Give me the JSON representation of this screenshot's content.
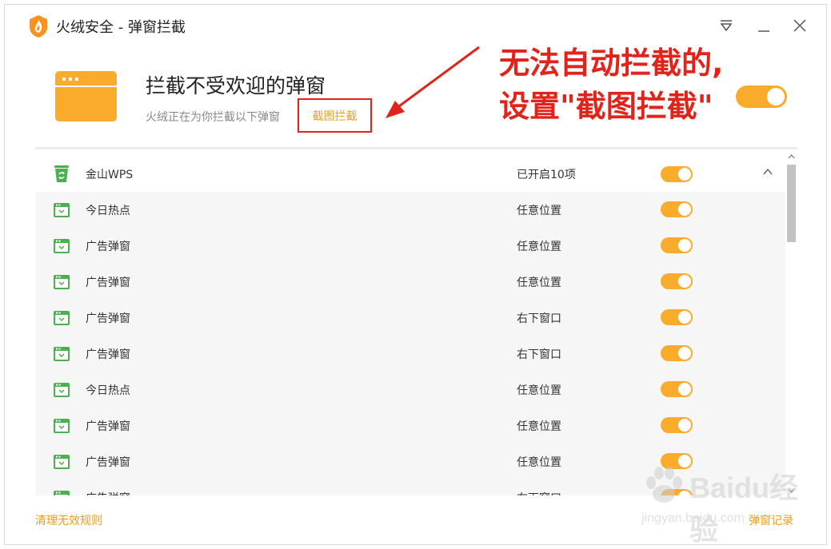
{
  "window": {
    "title": "火绒安全 - 弹窗拦截"
  },
  "header": {
    "title": "拦截不受欢迎的弹窗",
    "subtitle": "火绒正在为你拦截以下弹窗",
    "screenshot_link": "截图拦截"
  },
  "annotation": {
    "line1": "无法自动拦截的,",
    "line2": "设置\"截图拦截\"",
    "toggle_on": true
  },
  "group": {
    "name": "金山WPS",
    "status": "已开启10项",
    "enabled": true
  },
  "rows": [
    {
      "name": "今日热点",
      "position": "任意位置",
      "enabled": true
    },
    {
      "name": "广告弹窗",
      "position": "任意位置",
      "enabled": true
    },
    {
      "name": "广告弹窗",
      "position": "任意位置",
      "enabled": true
    },
    {
      "name": "广告弹窗",
      "position": "右下窗口",
      "enabled": true
    },
    {
      "name": "广告弹窗",
      "position": "右下窗口",
      "enabled": true
    },
    {
      "name": "今日热点",
      "position": "任意位置",
      "enabled": true
    },
    {
      "name": "广告弹窗",
      "position": "任意位置",
      "enabled": true
    },
    {
      "name": "广告弹窗",
      "position": "任意位置",
      "enabled": true
    },
    {
      "name": "广告弹窗",
      "position": "右下窗口",
      "enabled": true
    }
  ],
  "footer": {
    "left_link": "清理无效规则",
    "right_link": "弹窗记录"
  },
  "watermark": {
    "text": "Baidu经验",
    "url": "jingyan.baidu.com"
  },
  "colors": {
    "accent": "#f9ab2c",
    "link": "#f39c12",
    "annotation_red": "#e2231a",
    "row_bg": "#f6f6f6",
    "icon_green": "#4caf50"
  },
  "icons": {
    "app": "flame-shield-icon",
    "menu": "menu-triangle-icon",
    "minimize": "minimize-icon",
    "close": "close-icon",
    "hero": "browser-window-icon",
    "group": "recycle-bin-icon",
    "row": "popup-window-icon",
    "collapse": "chevron-up-icon"
  }
}
